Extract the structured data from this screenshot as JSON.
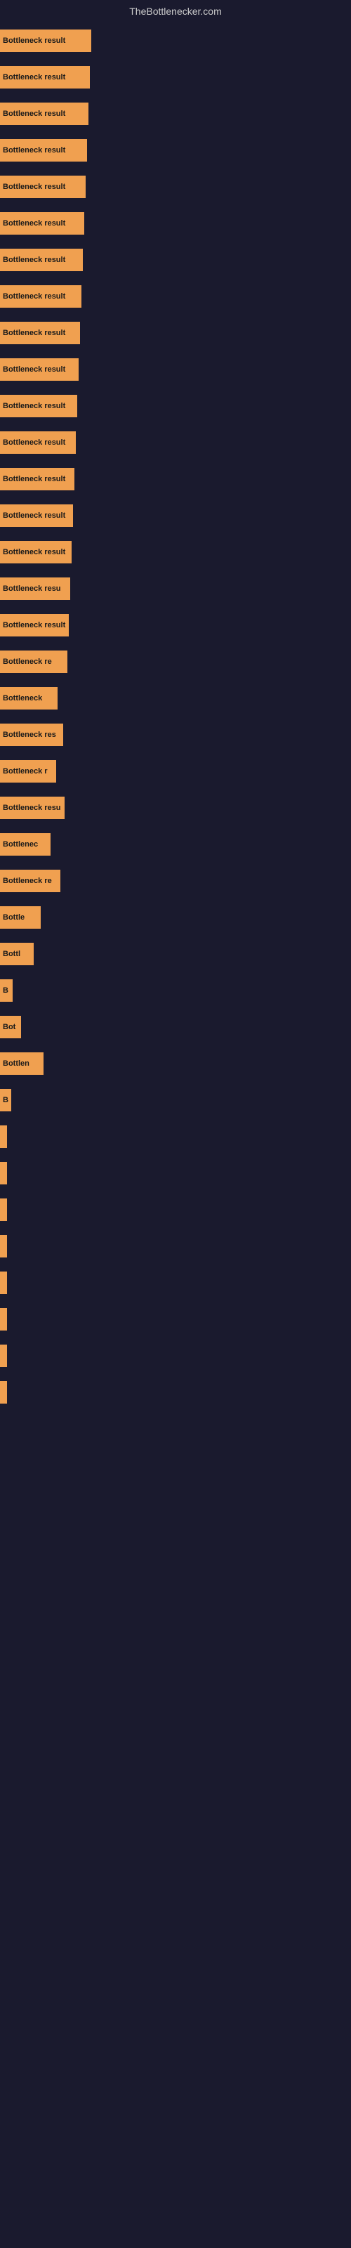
{
  "header": {
    "title": "TheBottlenecker.com"
  },
  "bars": [
    {
      "label": "Bottleneck result",
      "width": 130
    },
    {
      "label": "Bottleneck result",
      "width": 128
    },
    {
      "label": "Bottleneck result",
      "width": 126
    },
    {
      "label": "Bottleneck result",
      "width": 124
    },
    {
      "label": "Bottleneck result",
      "width": 122
    },
    {
      "label": "Bottleneck result",
      "width": 120
    },
    {
      "label": "Bottleneck result",
      "width": 118
    },
    {
      "label": "Bottleneck result",
      "width": 116
    },
    {
      "label": "Bottleneck result",
      "width": 114
    },
    {
      "label": "Bottleneck result",
      "width": 112
    },
    {
      "label": "Bottleneck result",
      "width": 110
    },
    {
      "label": "Bottleneck result",
      "width": 108
    },
    {
      "label": "Bottleneck result",
      "width": 106
    },
    {
      "label": "Bottleneck result",
      "width": 104
    },
    {
      "label": "Bottleneck result",
      "width": 102
    },
    {
      "label": "Bottleneck resu",
      "width": 100
    },
    {
      "label": "Bottleneck result",
      "width": 98
    },
    {
      "label": "Bottleneck re",
      "width": 96
    },
    {
      "label": "Bottleneck",
      "width": 82
    },
    {
      "label": "Bottleneck res",
      "width": 90
    },
    {
      "label": "Bottleneck r",
      "width": 80
    },
    {
      "label": "Bottleneck resu",
      "width": 92
    },
    {
      "label": "Bottlenec",
      "width": 72
    },
    {
      "label": "Bottleneck re",
      "width": 86
    },
    {
      "label": "Bottle",
      "width": 58
    },
    {
      "label": "Bottl",
      "width": 48
    },
    {
      "label": "B",
      "width": 18
    },
    {
      "label": "Bot",
      "width": 30
    },
    {
      "label": "Bottlen",
      "width": 62
    },
    {
      "label": "B",
      "width": 16
    },
    {
      "label": "",
      "width": 8
    },
    {
      "label": "",
      "width": 4
    },
    {
      "label": "",
      "width": 2
    },
    {
      "label": "",
      "width": 10
    },
    {
      "label": "",
      "width": 6
    },
    {
      "label": "",
      "width": 4
    },
    {
      "label": "",
      "width": 2
    },
    {
      "label": "",
      "width": 1
    }
  ]
}
